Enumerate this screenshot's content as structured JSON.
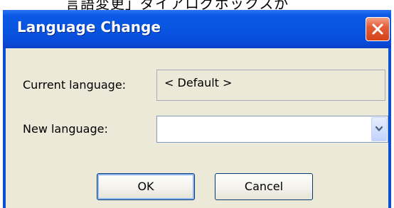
{
  "background_caption": "言語変更」ダイアログボックスが",
  "dialog": {
    "title": "Language Change",
    "current_language_label": "Current language:",
    "current_language_value": "< Default >",
    "new_language_label": "New language:",
    "new_language_value": "",
    "ok_label": "OK",
    "cancel_label": "Cancel"
  },
  "icons": {
    "close": "close-icon",
    "dropdown": "chevron-down-icon"
  },
  "colors": {
    "titlebar": "#0754e0",
    "client_background": "#ece9d8",
    "close_button": "#e45e37"
  }
}
